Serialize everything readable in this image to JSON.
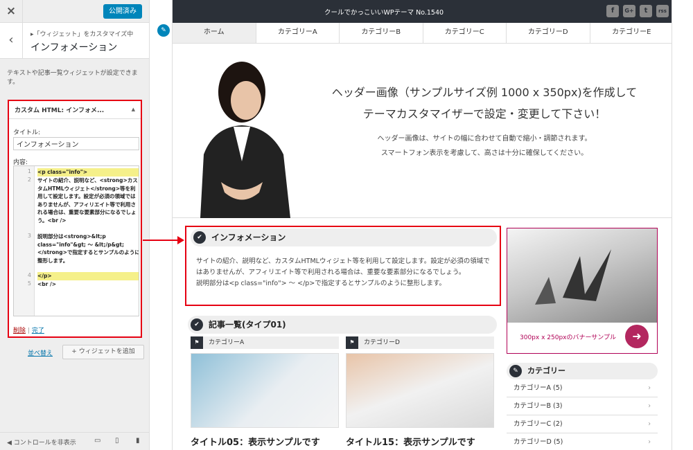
{
  "customizer": {
    "close_icon": "×",
    "publish_label": "公開済み",
    "back_icon": "‹",
    "breadcrumb": "▸「ウィジェット」をカスタマイズ中",
    "section_title": "インフォメーション",
    "description": "テキストや記事一覧ウィジェットが設定できます。",
    "widget": {
      "header": "カスタム HTML: インフォメ...",
      "title_label": "タイトル:",
      "title_value": "インフォメーション",
      "content_label": "内容:",
      "code_lines": [
        {
          "num": "1",
          "text": "<p class=\"info\">"
        },
        {
          "num": "2",
          "text": "サイトの紹介、説明など、<strong>カスタムHTMLウィジェト</strong>等を利用して設定します。設定が必須の領域ではありませんが、アフィリエイト等で利用される場合は、重要な要素部分になるでしょう。<br />"
        },
        {
          "num": "3",
          "text": "説明部分は<strong>&lt;p class=\"info\"&gt; 〜 &lt;/p&gt;</strong>で指定するとサンプルのように整形します。"
        },
        {
          "num": "4",
          "text": "</p>"
        },
        {
          "num": "5",
          "text": "<br />"
        }
      ],
      "delete_label": "削除",
      "separator": "|",
      "done_label": "完了"
    },
    "reorder_label": "並べ替え",
    "add_widget_label": "+ ウィジェットを追加",
    "hide_controls_label": "コントロールを非表示",
    "device_icons": [
      "desktop-icon",
      "tablet-icon",
      "mobile-icon"
    ]
  },
  "preview": {
    "site_title": "クールでかっこいいWPテーマ No.1540",
    "social_icons": [
      "f",
      "G+",
      "t",
      "rss"
    ],
    "nav": [
      "ホーム",
      "カテゴリーA",
      "カテゴリーB",
      "カテゴリーC",
      "カテゴリーD",
      "カテゴリーE"
    ],
    "hero": {
      "line1": "ヘッダー画像（サンプルサイズ例 1000 x 350px)を作成して",
      "line2": "テーマカスタマイザーで設定・変更して下さい！",
      "line3": "ヘッダー画像は、サイトの幅に合わせて自動で縮小・調節されます。",
      "line4": "スマートフォン表示を考慮して、高さは十分に確保してください。"
    },
    "info": {
      "title": "インフォメーション",
      "body1": "サイトの紹介、説明など、カスタムHTMLウィジェト等を利用して設定します。設定が必須の領域ではありませんが、アフィリエイト等で利用される場合は、重要な要素部分になるでしょう。",
      "body2": "説明部分は<p class=\"info\"> 〜 </p>で指定するとサンプルのように整形します。"
    },
    "articles": {
      "title": "記事一覧(タイプ01)",
      "cards": [
        {
          "category": "カテゴリーA",
          "title": "タイトル05：表示サンプルです"
        },
        {
          "category": "カテゴリーD",
          "title": "タイトル15：表示サンプルです"
        }
      ]
    },
    "banner_text": "300px x 250pxのバナーサンプル",
    "categories": {
      "title": "カテゴリー",
      "items": [
        "カテゴリーA (5)",
        "カテゴリーB (3)",
        "カテゴリーC (2)",
        "カテゴリーD (5)"
      ]
    }
  },
  "colors": {
    "accent": "#e60012",
    "dark": "#2b3038",
    "wp_blue": "#0085ba",
    "banner": "#b3275f"
  }
}
